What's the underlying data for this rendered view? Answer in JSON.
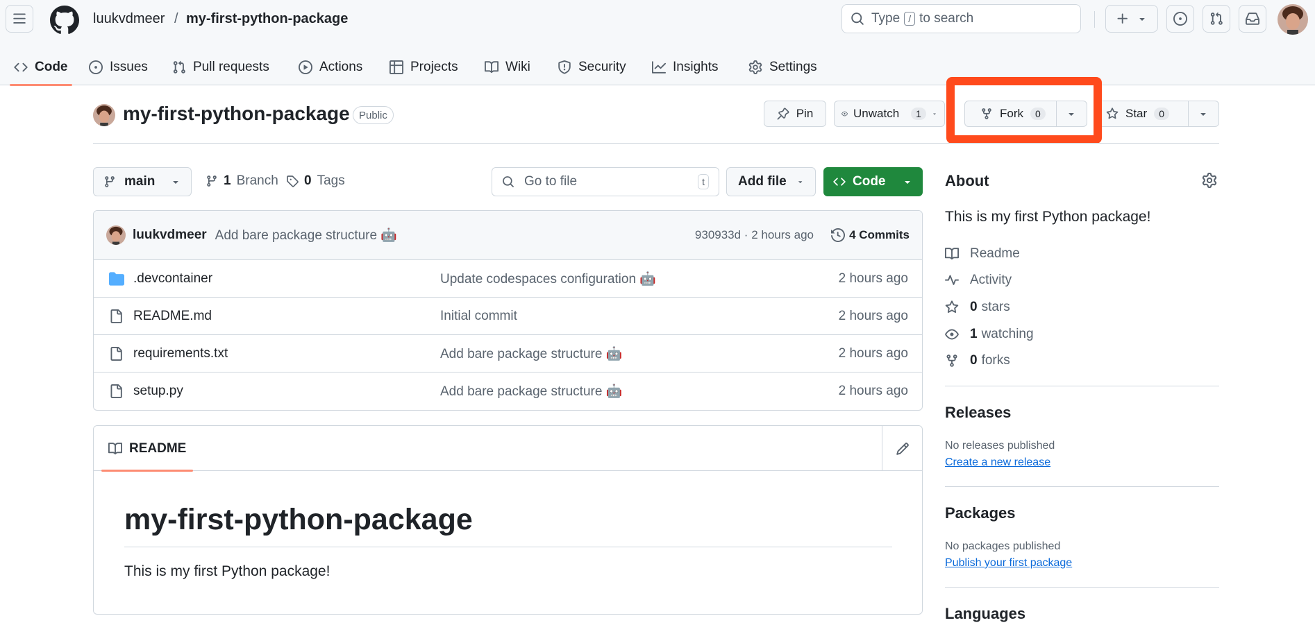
{
  "header": {
    "owner": "luukvdmeer",
    "separator": "/",
    "repo": "my-first-python-package",
    "search_prefix": "Type",
    "search_key": "/",
    "search_suffix": "to search"
  },
  "tabs": [
    {
      "label": "Code",
      "icon": "code-icon",
      "active": true
    },
    {
      "label": "Issues",
      "icon": "issue-icon"
    },
    {
      "label": "Pull requests",
      "icon": "pull-request-icon"
    },
    {
      "label": "Actions",
      "icon": "play-icon"
    },
    {
      "label": "Projects",
      "icon": "table-icon"
    },
    {
      "label": "Wiki",
      "icon": "book-icon"
    },
    {
      "label": "Security",
      "icon": "shield-icon"
    },
    {
      "label": "Insights",
      "icon": "graph-icon"
    },
    {
      "label": "Settings",
      "icon": "gear-icon"
    }
  ],
  "repo_header": {
    "title": "my-first-python-package",
    "visibility": "Public",
    "pin_label": "Pin",
    "unwatch_label": "Unwatch",
    "watch_count": "1",
    "fork_label": "Fork",
    "fork_count": "0",
    "star_label": "Star",
    "star_count": "0",
    "highlight_color": "#ff4a1c"
  },
  "branch_bar": {
    "branch": "main",
    "branches_count": "1",
    "branches_label": "Branch",
    "tags_count": "0",
    "tags_label": "Tags",
    "goto_placeholder": "Go to file",
    "goto_key": "t",
    "add_file_label": "Add file",
    "code_label": "Code",
    "code_color": "#1f883d"
  },
  "latest_commit": {
    "author": "luukvdmeer",
    "message": "Add bare package structure 🤖",
    "hash_time": "930933d · 2 hours ago",
    "commits_label": "4 Commits"
  },
  "files": [
    {
      "name": ".devcontainer",
      "type": "folder",
      "message": "Update codespaces configuration 🤖",
      "time": "2 hours ago"
    },
    {
      "name": "README.md",
      "type": "file",
      "message": "Initial commit",
      "time": "2 hours ago"
    },
    {
      "name": "requirements.txt",
      "type": "file",
      "message": "Add bare package structure 🤖",
      "time": "2 hours ago"
    },
    {
      "name": "setup.py",
      "type": "file",
      "message": "Add bare package structure 🤖",
      "time": "2 hours ago"
    }
  ],
  "readme": {
    "tab_label": "README",
    "heading": "my-first-python-package",
    "body": "This is my first Python package!"
  },
  "about": {
    "heading": "About",
    "description": "This is my first Python package!",
    "readme_label": "Readme",
    "activity_label": "Activity",
    "stars_count": "0",
    "stars_label": "stars",
    "watching_count": "1",
    "watching_label": "watching",
    "forks_count": "0",
    "forks_label": "forks"
  },
  "releases": {
    "heading": "Releases",
    "note": "No releases published",
    "link": "Create a new release"
  },
  "packages": {
    "heading": "Packages",
    "note": "No packages published",
    "link": "Publish your first package"
  },
  "languages": {
    "heading": "Languages"
  }
}
